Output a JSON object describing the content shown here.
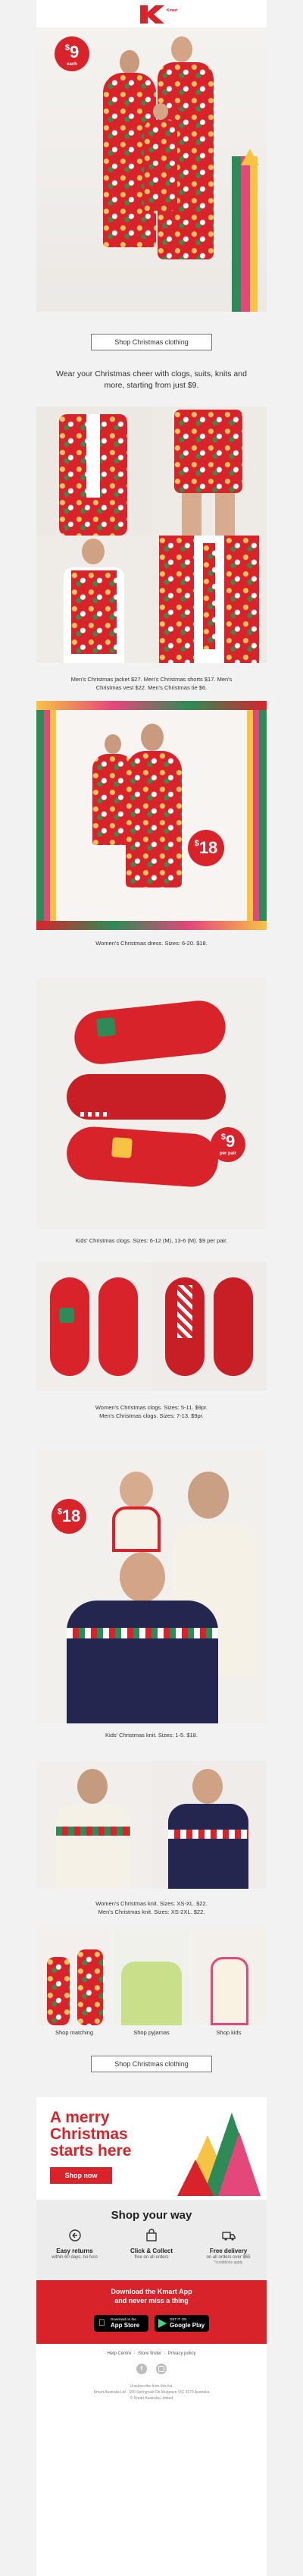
{
  "header": {
    "logo": "Kmart"
  },
  "hero": {
    "price": "9",
    "currency": "$",
    "price_note": "each"
  },
  "cta_top": {
    "label": "Shop Christmas clothing"
  },
  "intro": {
    "text": "Wear your Christmas cheer with clogs, suits, knits and more, starting from just $9."
  },
  "suits": {
    "caption": "Men's Christmas jacket $27. Men's Christmas shorts $17. Men's Christmas vest $22. Men's Christmas tie $6."
  },
  "dresses": {
    "caption": "Women's Christmas dress. Sizes: 6-20. $18.",
    "price": "18",
    "currency": "$"
  },
  "kids_clogs": {
    "caption": "Kids' Christmas clogs. Sizes: 6-12 (M), 13-6 (M). $9 per pair.",
    "price": "9",
    "currency": "$",
    "price_note": "per pair"
  },
  "adult_clogs": {
    "caption_1": "Women's Christmas clogs. Sizes: 5-11. $9pr.",
    "caption_2": "Men's Christmas clogs. Sizes: 7-13. $9pr."
  },
  "kids_knit": {
    "caption": "Kids' Christmas knit. Sizes: 1-5. $18.",
    "price": "18",
    "currency": "$"
  },
  "adult_knits": {
    "caption_1": "Women's Christmas knit. Sizes: XS-XL. $22.",
    "caption_2": "Men's Christmas knit. Sizes: XS-2XL. $22."
  },
  "shop_tiles": [
    {
      "label": "Shop matching"
    },
    {
      "label": "Shop pyjamas"
    },
    {
      "label": "Shop kids"
    }
  ],
  "cta_bottom": {
    "label": "Shop Christmas clothing"
  },
  "banner": {
    "line1": "A merry",
    "line2": "Christmas",
    "line3": "starts here",
    "button": "Shop now"
  },
  "shop_your_way": {
    "title": "Shop your way",
    "items": [
      {
        "title": "Easy returns",
        "text": "within 60 days, no fuss"
      },
      {
        "title": "Click & Collect",
        "text": "free on all orders"
      },
      {
        "title": "Free delivery",
        "text": "on all orders over $65",
        "note": "*conditions apply"
      }
    ]
  },
  "app": {
    "title_line1": "Download the Kmart App",
    "title_line2": "and never miss a thing",
    "app_store": "App Store",
    "google_play": "Google Play",
    "app_store_small": "Download on the",
    "google_play_small": "GET IT ON"
  },
  "footer": {
    "links": [
      "Help Centre",
      "Store finder",
      "Privacy policy"
    ],
    "line1": "Unsubscribe from this list.",
    "line2": "Kmart Australia Ltd · 690 Springvale Rd Mulgrave VIC 3170 Australia",
    "line3": "© Kmart Australia Limited"
  },
  "colors": {
    "brand_red": "#d8232a",
    "pink": "#e4477a",
    "green": "#2e8b57",
    "navy": "#2a2f66"
  }
}
